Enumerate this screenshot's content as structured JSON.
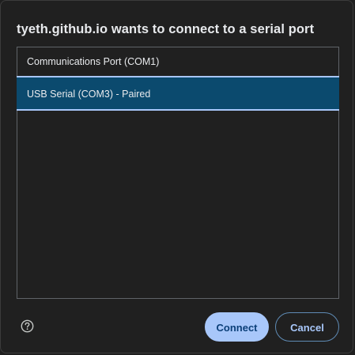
{
  "dialog": {
    "title": "tyeth.github.io wants to connect to a serial port"
  },
  "ports": [
    {
      "label": "Communications Port (COM1)",
      "selected": false
    },
    {
      "label": "USB Serial (COM3) - Paired",
      "selected": true
    }
  ],
  "footer": {
    "help_icon": "help-circle-icon",
    "connect_label": "Connect",
    "cancel_label": "Cancel"
  },
  "colors": {
    "background": "#202020",
    "selected_row": "#0b4a6e",
    "selected_border": "#a8c7fa",
    "primary_button": "#a8c7fa",
    "primary_button_text": "#0b3f78"
  }
}
